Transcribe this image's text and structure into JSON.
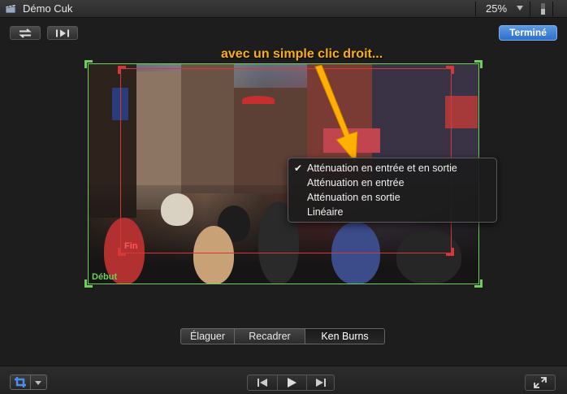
{
  "window": {
    "title": "Démo Cuk",
    "zoom_level": "25%"
  },
  "toolbar": {
    "done_label": "Terminé"
  },
  "annotation": {
    "text": "avec un simple clic droit..."
  },
  "viewer": {
    "start_label": "Début",
    "end_label": "Fin"
  },
  "context_menu": {
    "items": [
      {
        "label": "Atténuation en entrée et en sortie",
        "checked": "✔"
      },
      {
        "label": "Atténuation en entrée",
        "checked": ""
      },
      {
        "label": "Atténuation en sortie",
        "checked": ""
      },
      {
        "label": "Linéaire",
        "checked": ""
      }
    ]
  },
  "mode_selector": {
    "items": [
      "Élaguer",
      "Recadrer",
      "Ken Burns"
    ],
    "selected": "Ken Burns"
  },
  "colors": {
    "accent_blue": "#3d82dd",
    "start_green": "#6fcf5a",
    "end_red": "#d63838",
    "annotation_orange": "#ffb000"
  },
  "icons": {
    "app": "clapperboard-icon",
    "swap": "swap-arrows-icon",
    "play_region": "play-around-icon",
    "crop": "crop-icon",
    "prev": "previous-frame-icon",
    "play": "play-icon",
    "next": "next-frame-icon",
    "fullscreen": "fullscreen-icon"
  }
}
